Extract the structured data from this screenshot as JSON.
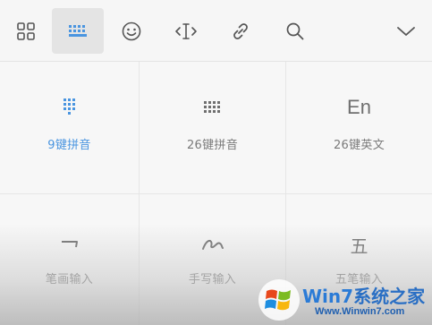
{
  "toolbar": {
    "buttons": [
      {
        "icon": "grid-icon"
      },
      {
        "icon": "keyboard-icon",
        "active": true
      },
      {
        "icon": "emoji-icon"
      },
      {
        "icon": "cursor-move-icon"
      },
      {
        "icon": "link-icon"
      },
      {
        "icon": "search-icon"
      },
      {
        "icon": "chevron-down-icon"
      }
    ],
    "icon_color": "#555555",
    "active_color": "#4a95e0"
  },
  "input_methods": [
    {
      "label": "9键拼音",
      "icon": "nine-key-keypad-icon",
      "active": true
    },
    {
      "label": "26键拼音",
      "icon": "full-keyboard-icon"
    },
    {
      "label": "26键英文",
      "icon_text": "En"
    },
    {
      "label": "笔画输入",
      "icon": "stroke-icon"
    },
    {
      "label": "手写输入",
      "icon": "handwriting-icon"
    },
    {
      "label": "五笔输入",
      "icon_text": "五"
    }
  ],
  "watermark": {
    "logo": "windows-logo",
    "text_win7": "Win7",
    "text_cn": "系统之家",
    "url": "Www.Winwin7.com"
  }
}
